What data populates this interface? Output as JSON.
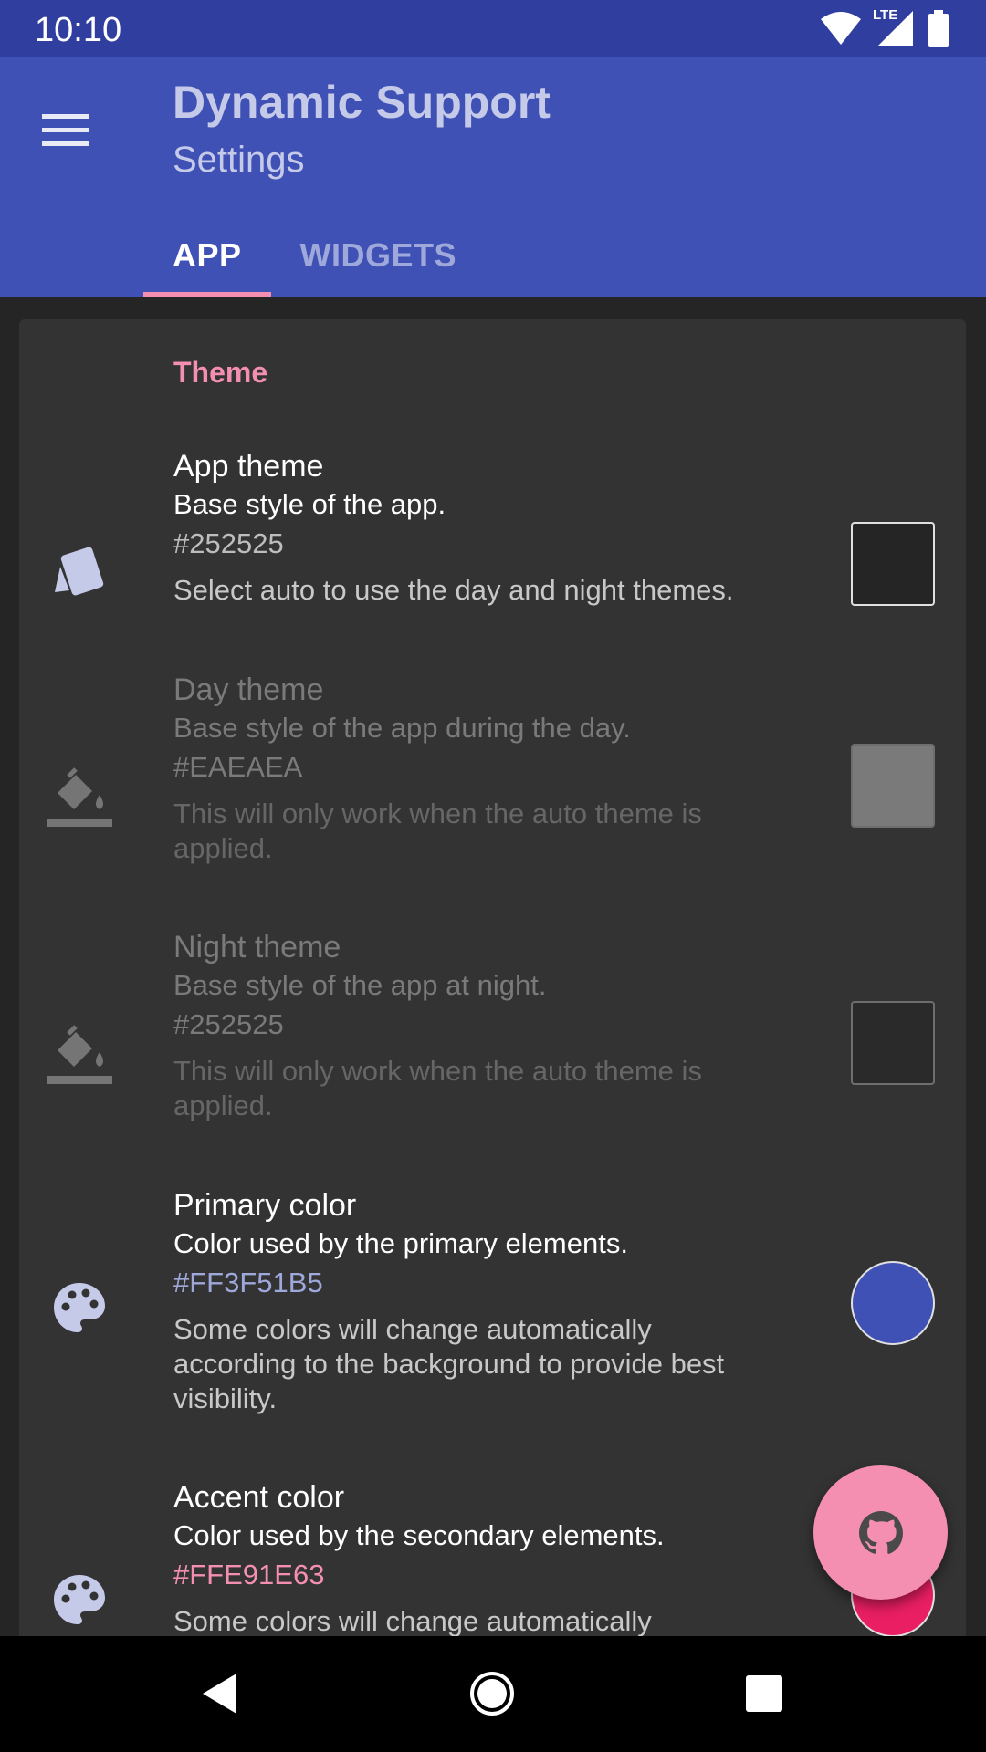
{
  "status_bar": {
    "time": "10:10",
    "network_label": "LTE"
  },
  "app_bar": {
    "title": "Dynamic Support",
    "subtitle": "Settings",
    "tabs": [
      {
        "label": "APP",
        "active": true
      },
      {
        "label": "WIDGETS",
        "active": false
      }
    ]
  },
  "section": {
    "title": "Theme"
  },
  "preferences": [
    {
      "icon": "theme-card-icon",
      "title": "App theme",
      "summary": "Base style of the app.",
      "value": "#252525",
      "description": "Select auto to use the day and night themes.",
      "swatch_color": "#252525",
      "enabled": true
    },
    {
      "icon": "paint-bucket-icon",
      "title": "Day theme",
      "summary": "Base style of the app during the day.",
      "value": "#EAEAEA",
      "description": "This will only work when the auto theme is applied.",
      "swatch_color": "#EAEAEA",
      "enabled": false
    },
    {
      "icon": "paint-bucket-icon",
      "title": "Night theme",
      "summary": "Base style of the app at night.",
      "value": "#252525",
      "description": "This will only work when the auto theme is applied.",
      "swatch_color": "#252525",
      "enabled": false
    },
    {
      "icon": "palette-icon",
      "title": "Primary color",
      "summary": "Color used by the primary elements.",
      "value": "#FF3F51B5",
      "value_color": "#9fa8da",
      "description": "Some colors will change automatically according to the background to provide best visibility.",
      "swatch_color": "#3F51B5",
      "enabled": true
    },
    {
      "icon": "palette-icon",
      "title": "Accent color",
      "summary": "Color used by the secondary elements.",
      "value": "#FFE91E63",
      "value_color": "#f48fb1",
      "description": "Some colors will change automatically",
      "swatch_color": "#E91E63",
      "enabled": true
    }
  ],
  "fab": {
    "icon": "github-icon"
  },
  "colors": {
    "status_bar": "#303f9f",
    "app_bar": "#3f51b5",
    "accent": "#f48fb1",
    "background": "#252525",
    "card": "#333333"
  }
}
